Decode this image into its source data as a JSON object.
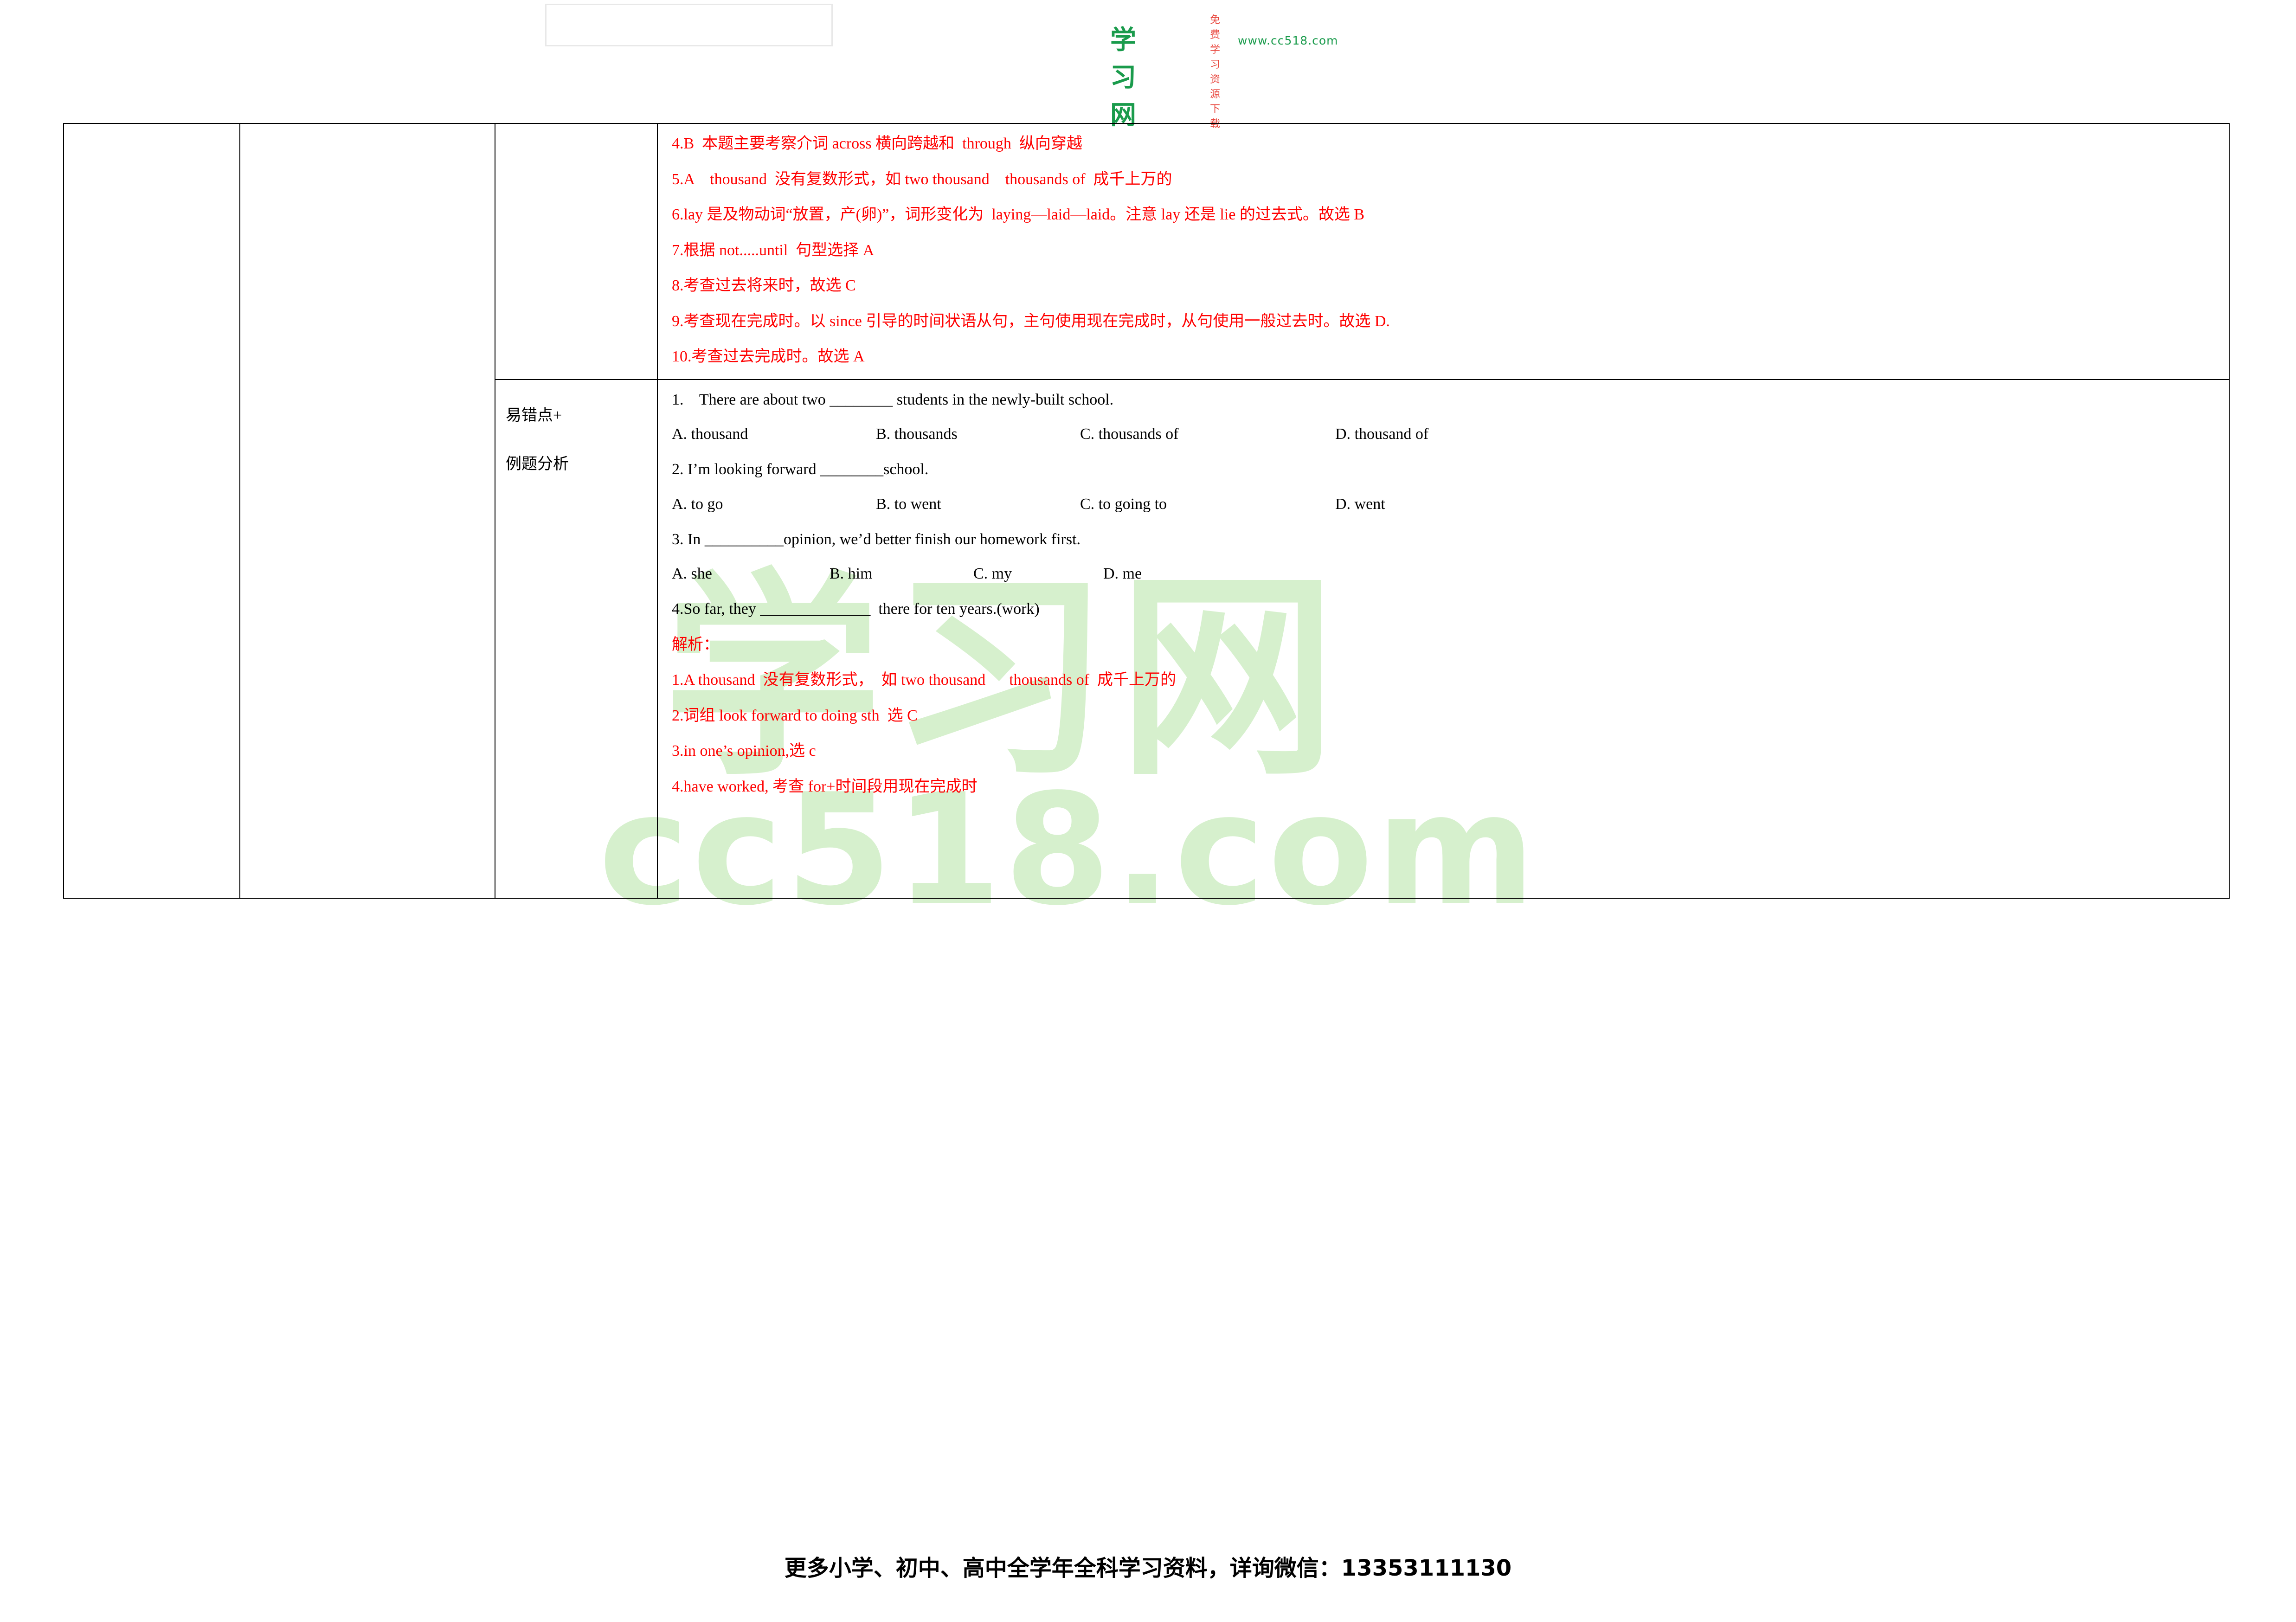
{
  "header": {
    "logo_tagline": "免费学习资源下载",
    "logo_main": "学习网",
    "logo_sub": "www.cc518.com"
  },
  "watermark": {
    "line1": "学习网",
    "line2": "cc518.com"
  },
  "table": {
    "section1": {
      "explanations": [
        "4.B  本题主要考察介词 across 横向跨越和  through  纵向穿越",
        "5.A    thousand  没有复数形式，如 two thousand    thousands of  成千上万的",
        "6.lay 是及物动词“放置，产(卵)”，词形变化为  laying—laid—laid。注意 lay 还是 lie 的过去式。故选 B",
        "7.根据 not.....until  句型选择 A",
        "8.考查过去将来时，故选 C",
        "9.考查现在完成时。以 since 引导的时间状语从句，主句使用现在完成时，从句使用一般过去时。故选 D.",
        "10.考查过去完成时。故选 A"
      ]
    },
    "section2": {
      "label_line1": "易错点+",
      "label_line2": "例题分析",
      "questions": [
        {
          "stem": "1.    There are about two ________ students in the newly-built school.",
          "options": [
            "A. thousand",
            "B. thousands",
            "C. thousands of",
            "D. thousand of"
          ],
          "layout": "wide"
        },
        {
          "stem": "2. I’m looking forward ________school.",
          "options": [
            "A. to go",
            "B. to went",
            "C. to going to",
            "D. went"
          ],
          "layout": "wide"
        },
        {
          "stem": "3. In __________opinion, we’d better finish our homework first.",
          "options": [
            "A. she",
            "B. him",
            "C. my",
            "D. me"
          ],
          "layout": "tight"
        }
      ],
      "question4": "4.So far, they ______________  there for ten years.(work)",
      "analysis_title": "解析：",
      "analysis": [
        "1.A thousand  没有复数形式，  如 two thousand      thousands of  成千上万的",
        "2.词组 look forward to doing sth  选 C",
        "3.in one’s opinion,选 c",
        "4.have worked, 考查 for+时间段用现在完成时"
      ]
    }
  },
  "footer": {
    "text": "更多小学、初中、高中全学年全科学习资料，详询微信：13353111130"
  }
}
